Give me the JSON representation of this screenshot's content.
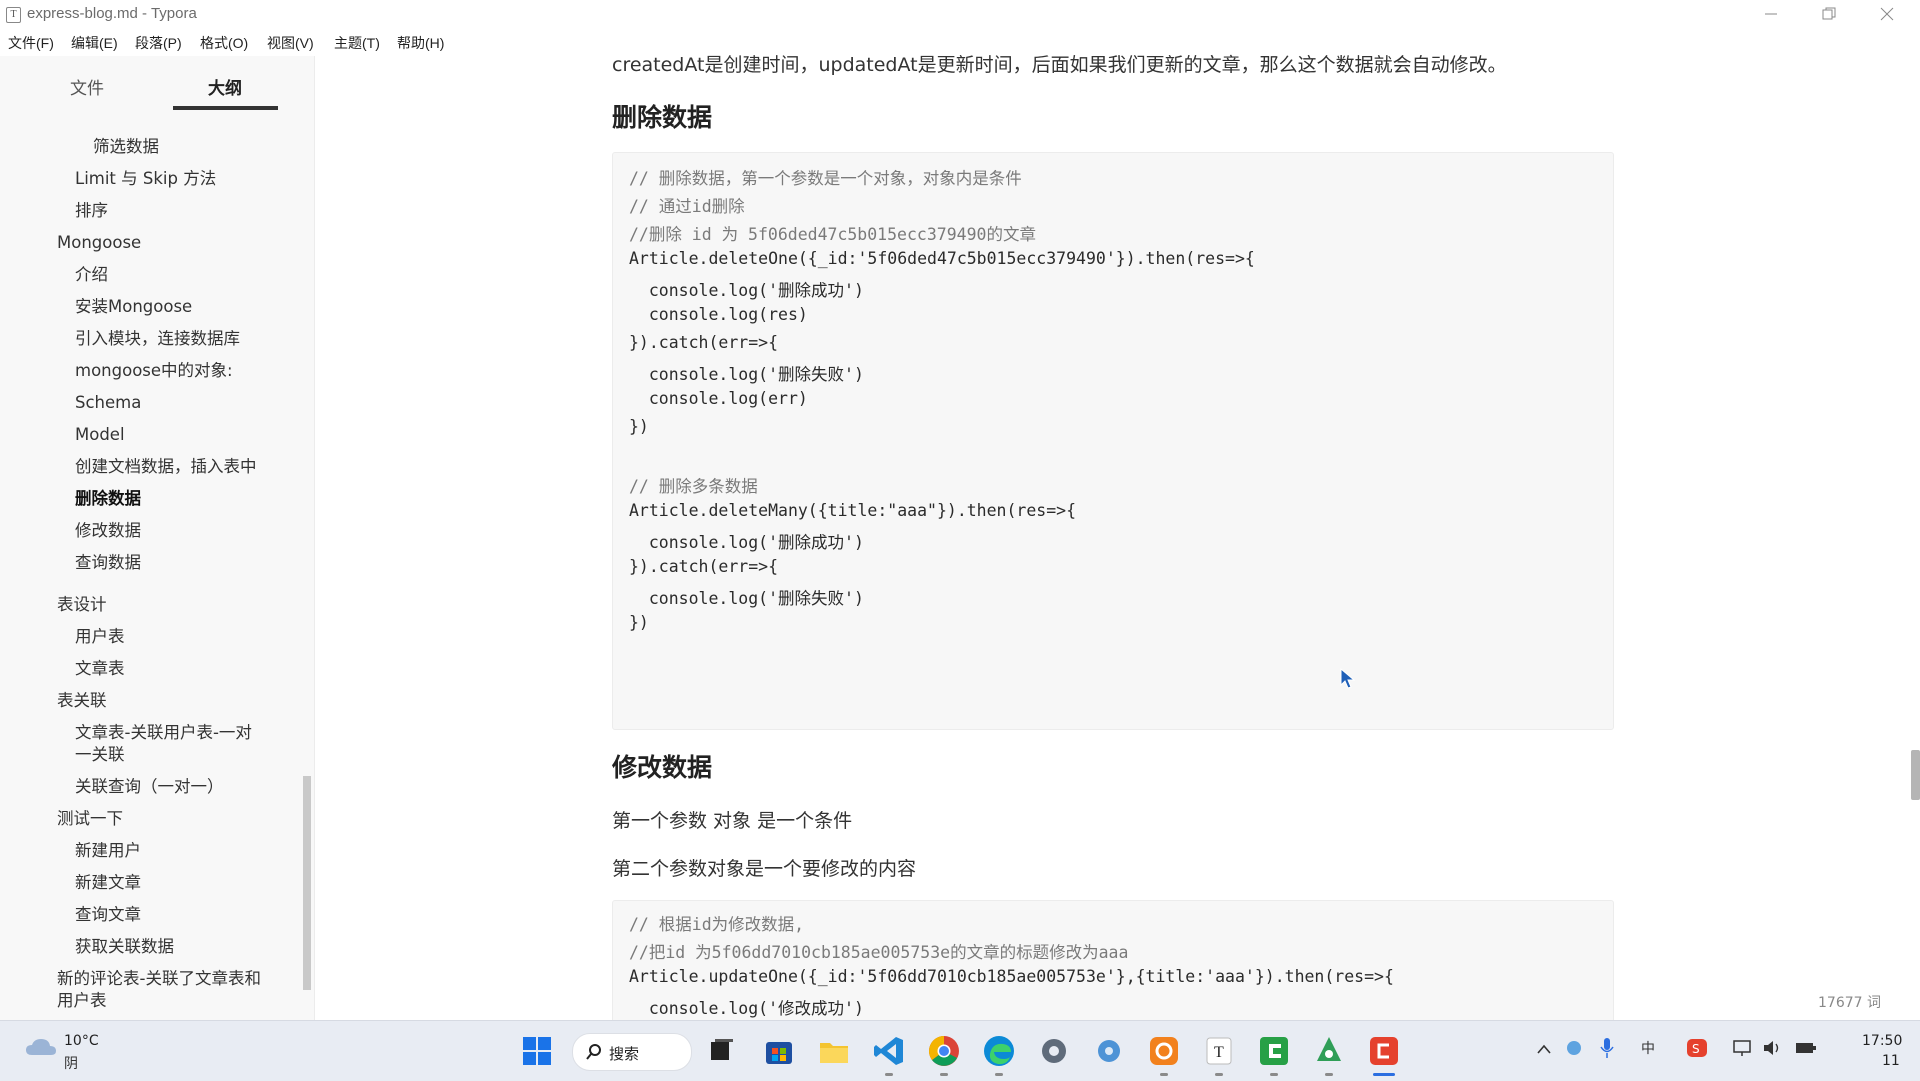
{
  "window": {
    "title": "express-blog.md - Typora",
    "app_icon_letter": "T"
  },
  "menubar": {
    "items": [
      "文件(F)",
      "编辑(E)",
      "段落(P)",
      "格式(O)",
      "视图(V)",
      "主题(T)",
      "帮助(H)"
    ]
  },
  "sidebar": {
    "tabs": {
      "files": "文件",
      "outline": "大纲"
    },
    "active_tab": "大纲",
    "outline": [
      {
        "label": "筛选数据",
        "level": 3
      },
      {
        "label": "Limit 与 Skip 方法",
        "level": 2
      },
      {
        "label": "排序",
        "level": 2
      },
      {
        "label": "Mongoose",
        "level": 1
      },
      {
        "label": "介绍",
        "level": 2
      },
      {
        "label": "安装Mongoose",
        "level": 2
      },
      {
        "label": "引入模块，连接数据库",
        "level": 2
      },
      {
        "label": "mongoose中的对象:",
        "level": 2
      },
      {
        "label": "Schema",
        "level": 2
      },
      {
        "label": "Model",
        "level": 2
      },
      {
        "label": "创建文档数据，插入表中",
        "level": 2
      },
      {
        "label": "删除数据",
        "level": 2,
        "active": true
      },
      {
        "label": "修改数据",
        "level": 2
      },
      {
        "label": "查询数据",
        "level": 2
      },
      {
        "label": "表设计",
        "level": 1
      },
      {
        "label": "用户表",
        "level": 2
      },
      {
        "label": "文章表",
        "level": 2
      },
      {
        "label": "表关联",
        "level": 1
      },
      {
        "label": "文章表-关联用户表-一对",
        "level": 2
      },
      {
        "label": "一关联",
        "level": 2
      },
      {
        "label": "关联查询（一对一）",
        "level": 2
      },
      {
        "label": "测试一下",
        "level": 1
      },
      {
        "label": "新建用户",
        "level": 2
      },
      {
        "label": "新建文章",
        "level": 2
      },
      {
        "label": "查询文章",
        "level": 2
      },
      {
        "label": "获取关联数据",
        "level": 2
      },
      {
        "label": "新的评论表-关联了文章表和",
        "level": 1
      },
      {
        "label": "用户表",
        "level": 1
      }
    ],
    "footer": {
      "collapse_icon": "‹",
      "source_icon": "</>"
    }
  },
  "editor": {
    "intro": "createdAt是创建时间，updatedAt是更新时间，后面如果我们更新的文章，那么这个数据就会自动修改。",
    "section1_heading": "删除数据",
    "code1": [
      {
        "text": "// 删除数据，第一个参数是一个对象，对象内是条件",
        "comment": true
      },
      {
        "text": "// 通过id删除",
        "comment": true
      },
      {
        "text": "//删除 id 为 5f06ded47c5b015ecc379490的文章",
        "comment": true
      },
      {
        "text": "Article.deleteOne({_id:'5f06ded47c5b015ecc379490'}).then(res=>{",
        "comment": false
      },
      {
        "text": "  console.log('删除成功')",
        "comment": false
      },
      {
        "text": "  console.log(res)",
        "comment": false
      },
      {
        "text": "}).catch(err=>{",
        "comment": false
      },
      {
        "text": "  console.log('删除失败')",
        "comment": false
      },
      {
        "text": "  console.log(err)",
        "comment": false
      },
      {
        "text": "})",
        "comment": false
      },
      {
        "text": "",
        "comment": false
      },
      {
        "text": "// 删除多条数据",
        "comment": true
      },
      {
        "text": "Article.deleteMany({title:\"aaa\"}).then(res=>{",
        "comment": false
      },
      {
        "text": "  console.log('删除成功')",
        "comment": false
      },
      {
        "text": "}).catch(err=>{",
        "comment": false
      },
      {
        "text": "  console.log('删除失败')",
        "comment": false
      },
      {
        "text": "})",
        "comment": false
      }
    ],
    "section2_heading": "修改数据",
    "para2a": "第一个参数 对象 是一个条件",
    "para2b": "第二个参数对象是一个要修改的内容",
    "code2": [
      {
        "text": "// 根据id为修改数据,",
        "comment": true
      },
      {
        "text": "//把id 为5f06dd7010cb185ae005753e的文章的标题修改为aaa",
        "comment": true
      },
      {
        "text": "Article.updateOne({_id:'5f06dd7010cb185ae005753e'},{title:'aaa'}).then(res=>{",
        "comment": false
      },
      {
        "text": "  console.log('修改成功')",
        "comment": false
      }
    ],
    "word_count": "17677 词"
  },
  "taskbar": {
    "weather_temp": "10°C",
    "weather_cond": "阴",
    "search_label": "搜索",
    "clock_time": "17:50",
    "clock_date": "11"
  },
  "colors": {
    "accent": "#3f5fbf",
    "sidebar_bg": "#f8f8f8",
    "code_bg": "#f7f7f7",
    "taskbar_bg": "#e8ecf3"
  }
}
